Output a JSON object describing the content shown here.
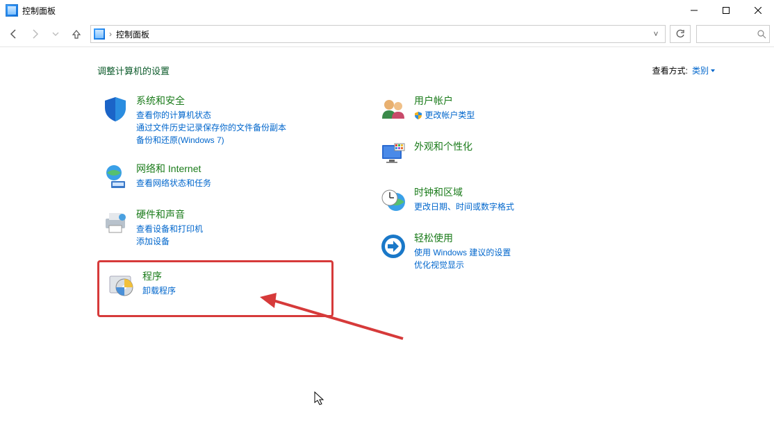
{
  "window": {
    "title": "控制面板"
  },
  "address": {
    "location": "控制面板"
  },
  "header": {
    "heading": "调整计算机的设置",
    "view_by_label": "查看方式:",
    "view_by_value": "类别"
  },
  "categories_left": [
    {
      "title": "系统和安全",
      "links": [
        "查看你的计算机状态",
        "通过文件历史记录保存你的文件备份副本",
        "备份和还原(Windows 7)"
      ]
    },
    {
      "title": "网络和 Internet",
      "links": [
        "查看网络状态和任务"
      ]
    },
    {
      "title": "硬件和声音",
      "links": [
        "查看设备和打印机",
        "添加设备"
      ]
    },
    {
      "title": "程序",
      "links": [
        "卸载程序"
      ]
    }
  ],
  "categories_right": [
    {
      "title": "用户帐户",
      "links": [
        "更改帐户类型"
      ]
    },
    {
      "title": "外观和个性化",
      "links": []
    },
    {
      "title": "时钟和区域",
      "links": [
        "更改日期、时间或数字格式"
      ]
    },
    {
      "title": "轻松使用",
      "links": [
        "使用 Windows 建议的设置",
        "优化视觉显示"
      ]
    }
  ]
}
